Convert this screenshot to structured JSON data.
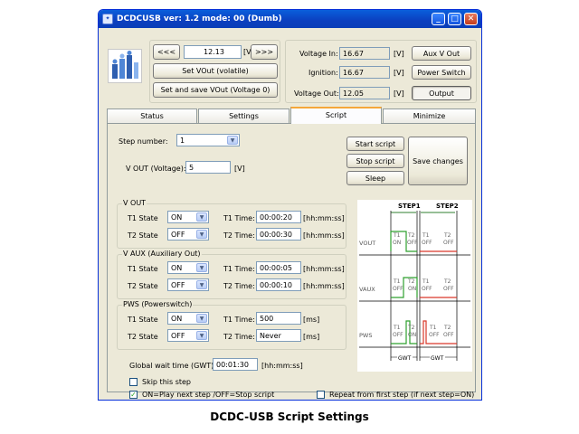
{
  "window": {
    "title": "DCDCUSB ver: 1.2 mode: 00 (Dumb)",
    "app_icon": "dcdc-app-icon",
    "controls": {
      "minimize": "_",
      "maximize": "□",
      "close": "✕"
    }
  },
  "header": {
    "dec_label": "<<<",
    "inc_label": ">>>",
    "vout_value": "12.13",
    "vout_unit": "[V]",
    "set_vout_label": "Set VOut (volatile)",
    "set_save_vout_label": "Set and save VOut (Voltage 0)",
    "voltage_in_label": "Voltage In:",
    "voltage_in_value": "16.67",
    "voltage_in_unit": "[V]",
    "ignition_label": "Ignition:",
    "ignition_value": "16.67",
    "ignition_unit": "[V]",
    "voltage_out_label": "Voltage Out:",
    "voltage_out_value": "12.05",
    "voltage_out_unit": "[V]",
    "aux_vout_label": "Aux V Out",
    "power_switch_label": "Power Switch",
    "output_label": "Output"
  },
  "tabs": [
    "Status",
    "Settings",
    "Script",
    "Minimize"
  ],
  "script": {
    "step_number_label": "Step number:",
    "step_number_value": "1",
    "vout_label": "V OUT (Voltage):",
    "vout_value": "5",
    "vout_unit": "[V]",
    "start_script_label": "Start script",
    "stop_script_label": "Stop script",
    "sleep_label": "Sleep",
    "save_changes_label": "Save changes",
    "groups": {
      "vout": {
        "title": "V OUT",
        "t1_state_label": "T1 State",
        "t1_state": "ON",
        "t1_time_label": "T1 Time:",
        "t1_time": "00:00:20",
        "t1_unit": "[hh:mm:ss]",
        "t2_state_label": "T2 State",
        "t2_state": "OFF",
        "t2_time_label": "T2 Time:",
        "t2_time": "00:00:30",
        "t2_unit": "[hh:mm:ss]"
      },
      "vaux": {
        "title": "V AUX (Auxiliary Out)",
        "t1_state_label": "T1 State",
        "t1_state": "ON",
        "t1_time_label": "T1 Time:",
        "t1_time": "00:00:05",
        "t1_unit": "[hh:mm:ss]",
        "t2_state_label": "T2 State",
        "t2_state": "OFF",
        "t2_time_label": "T2 Time:",
        "t2_time": "00:00:10",
        "t2_unit": "[hh:mm:ss]"
      },
      "pws": {
        "title": "PWS (Powerswitch)",
        "t1_state_label": "T1 State",
        "t1_state": "ON",
        "t1_time_label": "T1 Time:",
        "t1_time": "500",
        "t1_unit": "[ms]",
        "t2_state_label": "T2 State",
        "t2_state": "OFF",
        "t2_time_label": "T2 Time:",
        "t2_time": "Never",
        "t2_unit": "[ms]"
      }
    },
    "gwt_label": "Global wait time (GWT):",
    "gwt_value": "00:01:30",
    "gwt_unit": "[hh:mm:ss]",
    "skip_step_label": "Skip this step",
    "skip_step_checked": false,
    "on_play_label": "ON=Play next step /OFF=Stop script",
    "on_play_checked": true,
    "repeat_label": "Repeat from first step (if next step=ON)",
    "repeat_checked": false
  },
  "diagram": {
    "step1": "STEP1",
    "step2": "STEP2",
    "rows": [
      "VOUT",
      "VAUX",
      "PWS"
    ],
    "t1": "T1",
    "t2": "T2",
    "on": "ON",
    "off": "OFF",
    "gwt": "GWT",
    "colors": {
      "on": "#2ea02e",
      "off": "#d9382a",
      "step": "#2f7f2f"
    }
  },
  "caption": "DCDC-USB Script Settings"
}
